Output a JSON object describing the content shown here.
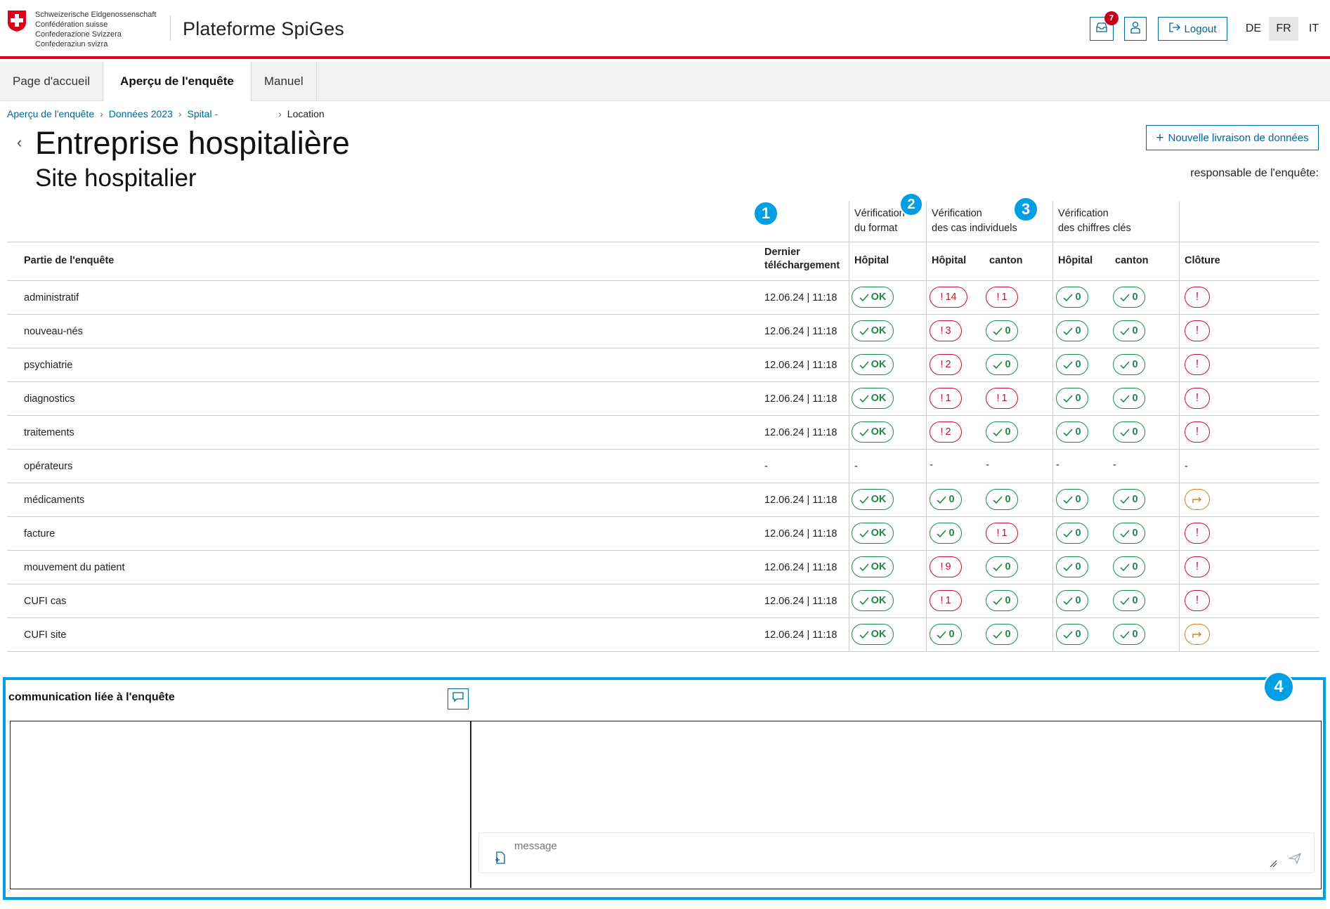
{
  "header": {
    "logo_lines": [
      "Schweizerische Eidgenossenschaft",
      "Confédération suisse",
      "Confederazione Svizzera",
      "Confederaziun svizra"
    ],
    "app_title": "Plateforme SpiGes",
    "notifications_count": "7",
    "logout_label": "Logout",
    "languages": [
      "DE",
      "FR",
      "IT"
    ],
    "active_language": "FR"
  },
  "nav": {
    "tabs": [
      {
        "label": "Page d'accueil"
      },
      {
        "label": "Aperçu de l'enquête",
        "active": true
      },
      {
        "label": "Manuel"
      }
    ]
  },
  "breadcrumb": [
    "Aperçu de l'enquête",
    "Données 2023",
    "Spital -",
    "Location"
  ],
  "page": {
    "title": "Entreprise hospitalière",
    "subtitle": "Site hospitalier",
    "new_delivery_label": "Nouvelle livraison de données",
    "responsible_label": "responsable de l'enquête:"
  },
  "table": {
    "group_headers": {
      "format": [
        "Vérification",
        "du format"
      ],
      "cases": [
        "Vérification",
        "des cas individuels"
      ],
      "keyfigures": [
        "Vérification",
        "des chiffres clés"
      ]
    },
    "columns": {
      "part": "Partie de l'enquête",
      "last_upload": [
        "Dernier",
        "téléchargement"
      ],
      "hospital": "Hôpital",
      "canton": "canton",
      "closure": "Clôture"
    },
    "ok_label": "OK",
    "markers": [
      "1",
      "2",
      "3",
      "4"
    ],
    "rows": [
      {
        "label": "administratif",
        "date": "12.06.24 | 11:18",
        "format": "ok",
        "case_h": "!14",
        "case_c": "!1",
        "key_h": "0",
        "key_c": "0",
        "closure": "err"
      },
      {
        "label": "nouveau-nés",
        "date": "12.06.24 | 11:18",
        "format": "ok",
        "case_h": "!3",
        "case_c": "0",
        "key_h": "0",
        "key_c": "0",
        "closure": "err"
      },
      {
        "label": "psychiatrie",
        "date": "12.06.24 | 11:18",
        "format": "ok",
        "case_h": "!2",
        "case_c": "0",
        "key_h": "0",
        "key_c": "0",
        "closure": "err"
      },
      {
        "label": "diagnostics",
        "date": "12.06.24 | 11:18",
        "format": "ok",
        "case_h": "!1",
        "case_c": "!1",
        "key_h": "0",
        "key_c": "0",
        "closure": "err"
      },
      {
        "label": "traitements",
        "date": "12.06.24 | 11:18",
        "format": "ok",
        "case_h": "!2",
        "case_c": "0",
        "key_h": "0",
        "key_c": "0",
        "closure": "err"
      },
      {
        "label": "opérateurs",
        "date": "-",
        "format": "-",
        "case_h": "-",
        "case_c": "-",
        "key_h": "-",
        "key_c": "-",
        "closure": "-"
      },
      {
        "label": "médicaments",
        "date": "12.06.24 | 11:18",
        "format": "ok",
        "case_h": "0",
        "case_c": "0",
        "key_h": "0",
        "key_c": "0",
        "closure": "fwd"
      },
      {
        "label": "facture",
        "date": "12.06.24 | 11:18",
        "format": "ok",
        "case_h": "0",
        "case_c": "!1",
        "key_h": "0",
        "key_c": "0",
        "closure": "err"
      },
      {
        "label": "mouvement du patient",
        "date": "12.06.24 | 11:18",
        "format": "ok",
        "case_h": "!9",
        "case_c": "0",
        "key_h": "0",
        "key_c": "0",
        "closure": "err"
      },
      {
        "label": "CUFI cas",
        "date": "12.06.24 | 11:18",
        "format": "ok",
        "case_h": "!1",
        "case_c": "0",
        "key_h": "0",
        "key_c": "0",
        "closure": "err"
      },
      {
        "label": "CUFI site",
        "date": "12.06.24 | 11:18",
        "format": "ok",
        "case_h": "0",
        "case_c": "0",
        "key_h": "0",
        "key_c": "0",
        "closure": "fwd"
      }
    ]
  },
  "communication": {
    "title": "communication liée à l'enquête",
    "message_placeholder": "message"
  },
  "colors": {
    "swiss_red": "#dc0018",
    "primary_blue": "#006699",
    "marker_blue": "#009ee3",
    "ok_green": "#1e8a45",
    "error_red": "#c8102e",
    "forward_orange": "#e07b2d"
  }
}
